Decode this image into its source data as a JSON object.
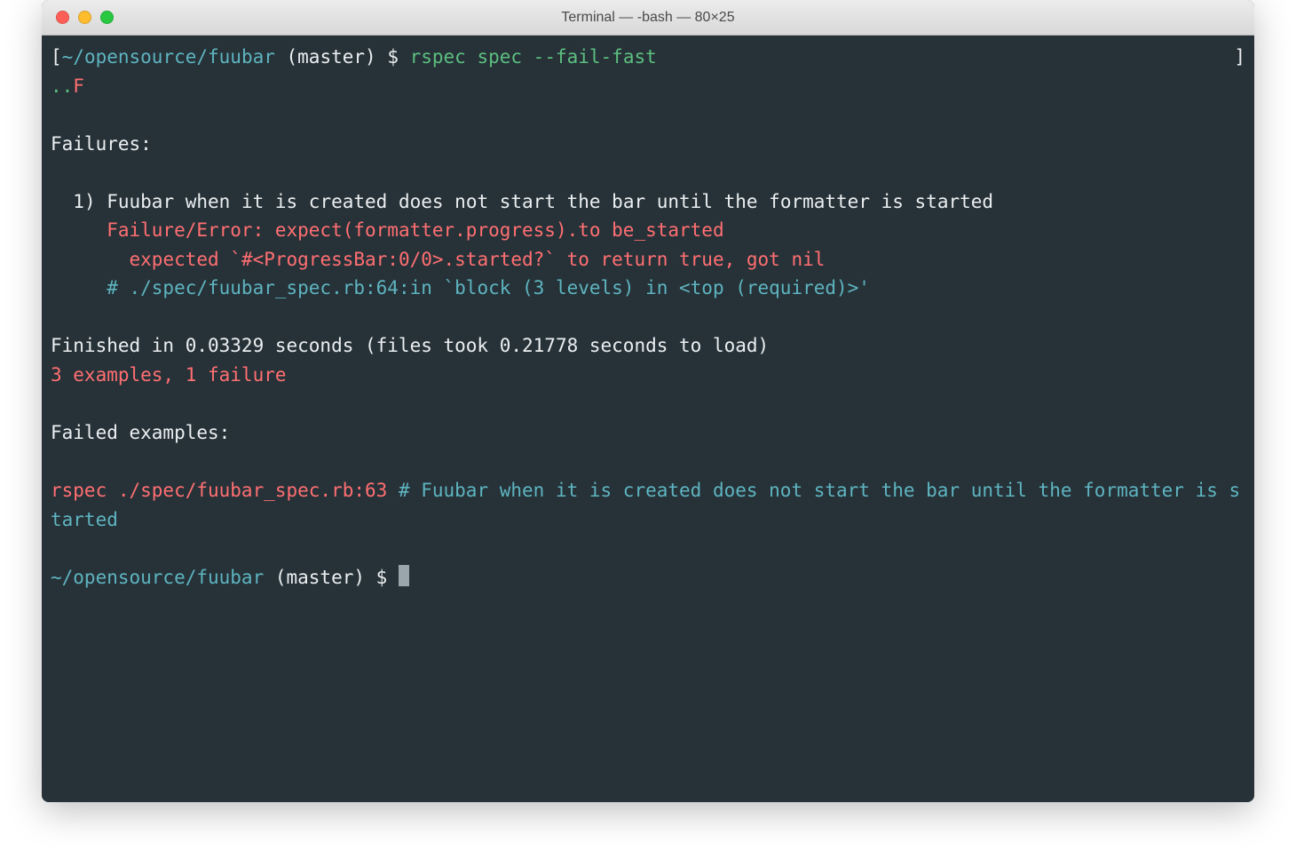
{
  "window": {
    "title": "Terminal — -bash — 80×25"
  },
  "colors": {
    "bg": "#263238",
    "cyan": "#5eb4c0",
    "green": "#5dbf80",
    "red": "#ff6f72",
    "white": "#eceff1"
  },
  "prompt": {
    "open_bracket": "[",
    "path": "~/opensource/fuubar",
    "branch": " (master)",
    "dollar": " $ ",
    "close_bracket": "]",
    "command": "rspec spec --fail-fast"
  },
  "dots": {
    "pass": "..",
    "fail": "F"
  },
  "failures_heading": "Failures:",
  "failure": {
    "index": "  1) ",
    "desc": "Fuubar when it is created does not start the bar until the formatter is started",
    "line_err": "     Failure/Error: expect(formatter.progress).to be_started",
    "line_expect": "       expected `#<ProgressBar:0/0>.started?` to return true, got nil",
    "line_trace": "     # ./spec/fuubar_spec.rb:64:in `block (3 levels) in <top (required)>'"
  },
  "summary": {
    "finished": "Finished in 0.03329 seconds (files took 0.21778 seconds to load)",
    "counts": "3 examples, 1 failure"
  },
  "failed_heading": "Failed examples:",
  "failed_example": {
    "cmd": "rspec ./spec/fuubar_spec.rb:63",
    "comment": " # Fuubar when it is created does not start the bar until the formatter is started"
  },
  "prompt2": {
    "path": "~/opensource/fuubar",
    "branch": " (master)",
    "dollar": " $ "
  }
}
